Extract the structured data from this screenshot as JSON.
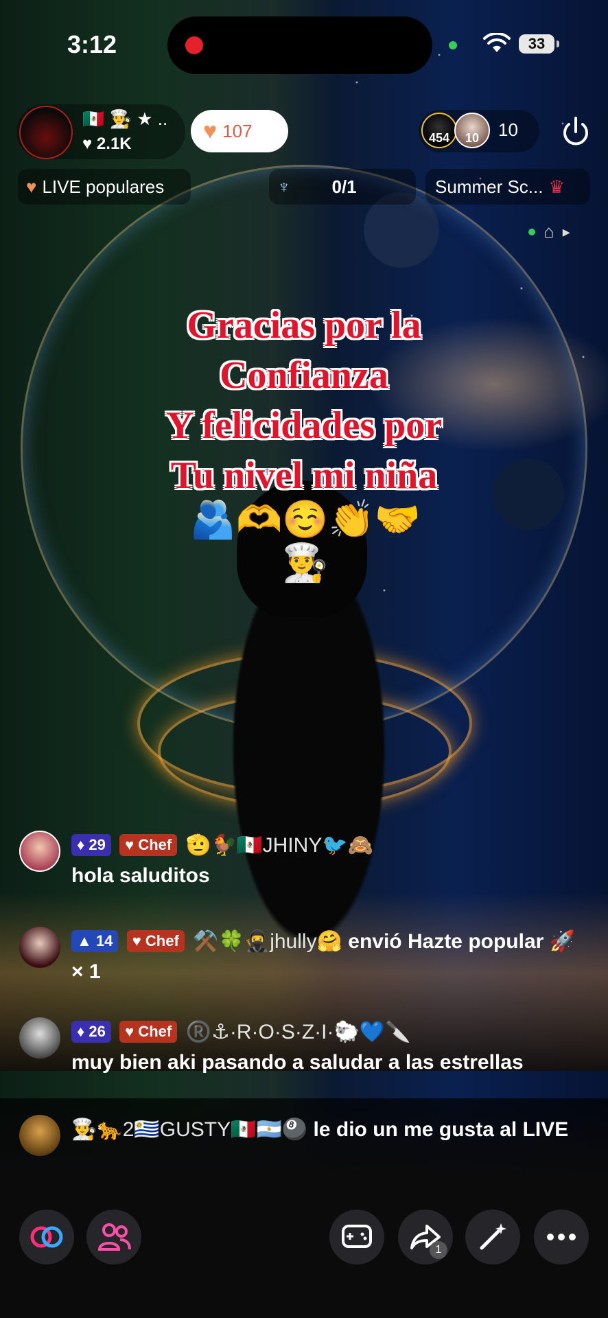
{
  "status_bar": {
    "time": "3:12",
    "battery": "33"
  },
  "header": {
    "host_badges": "🇲🇽 👨‍🍳 ★ ..",
    "host_likes": "2.1K",
    "like_count": "107",
    "viewer_avatar_1": "454",
    "viewer_avatar_2": "10",
    "viewer_count": "10"
  },
  "chips": {
    "live": "LIVE populares",
    "goal": "0/1",
    "summer": "Summer Sc..."
  },
  "overlay": {
    "lines": [
      "Gracias  por la",
      "Confianza",
      "Y felicidades por",
      "Tu nivel mi niña"
    ],
    "emoji": "🫂🫶☺️👏🤝👨‍🍳"
  },
  "chat": [
    {
      "level": "29",
      "role": "Chef",
      "name_prefix": "🫡🐓🇲🇽",
      "name": "JHINY",
      "name_suffix": "🐦🙈",
      "text": "hola saluditos"
    },
    {
      "level": "14",
      "role": "Chef",
      "name_prefix": "⚒️🍀🥷",
      "name": "jhully",
      "name_suffix": "🤗",
      "text": "envió Hazte popular 🚀 × 1"
    },
    {
      "level": "26",
      "role": "Chef",
      "name_prefix": "®️⚓",
      "name": "·R·O·S·Z·I·",
      "name_suffix": "🐑💙🔪",
      "text": "muy bien aki pasando a saludar a las estrellas"
    },
    {
      "name_prefix": "👨‍🍳🐆2🇺🇾",
      "name": "GUSTY",
      "name_suffix": "🇲🇽🇦🇷🎱",
      "text": "le dio un me gusta al LIVE"
    }
  ],
  "bottom_bar": {
    "share_count": "1"
  }
}
